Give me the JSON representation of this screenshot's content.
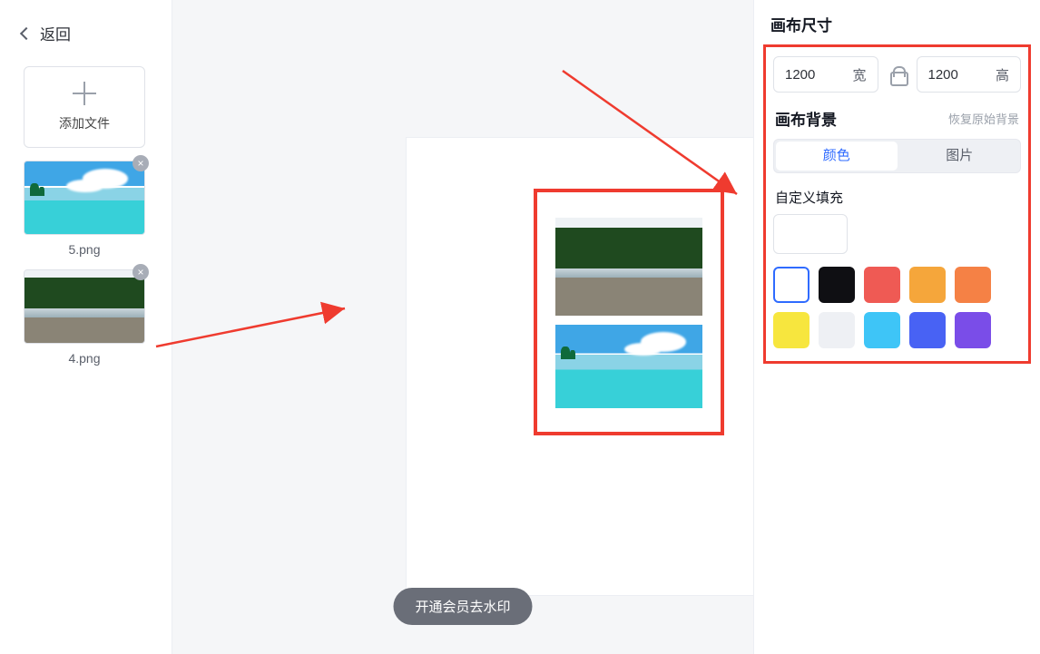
{
  "sidebar": {
    "back_label": "返回",
    "add_label": "添加文件",
    "files": [
      {
        "name": "5.png",
        "kind": "beach"
      },
      {
        "name": "4.png",
        "kind": "forest"
      }
    ]
  },
  "canvas": {
    "watermark_button": "开通会员去水印"
  },
  "panel": {
    "size_title": "画布尺寸",
    "width_value": "1200",
    "width_label": "宽",
    "height_value": "1200",
    "height_label": "高",
    "bg_title": "画布背景",
    "reset_label": "恢复原始背景",
    "tab_color": "颜色",
    "tab_image": "图片",
    "custom_fill_label": "自定义填充",
    "swatches": [
      {
        "hex": "#ffffff",
        "selected": true,
        "needs_border": true
      },
      {
        "hex": "#0f0f13",
        "selected": false
      },
      {
        "hex": "#ef5a54",
        "selected": false
      },
      {
        "hex": "#f5a63b",
        "selected": false
      },
      {
        "hex": "#f58145",
        "selected": false
      },
      {
        "hex": "#f7e63e",
        "selected": false
      },
      {
        "hex": "#eef0f4",
        "selected": false
      },
      {
        "hex": "#3ec5f7",
        "selected": false
      },
      {
        "hex": "#4862f4",
        "selected": false
      },
      {
        "hex": "#7a4de8",
        "selected": false
      }
    ]
  }
}
